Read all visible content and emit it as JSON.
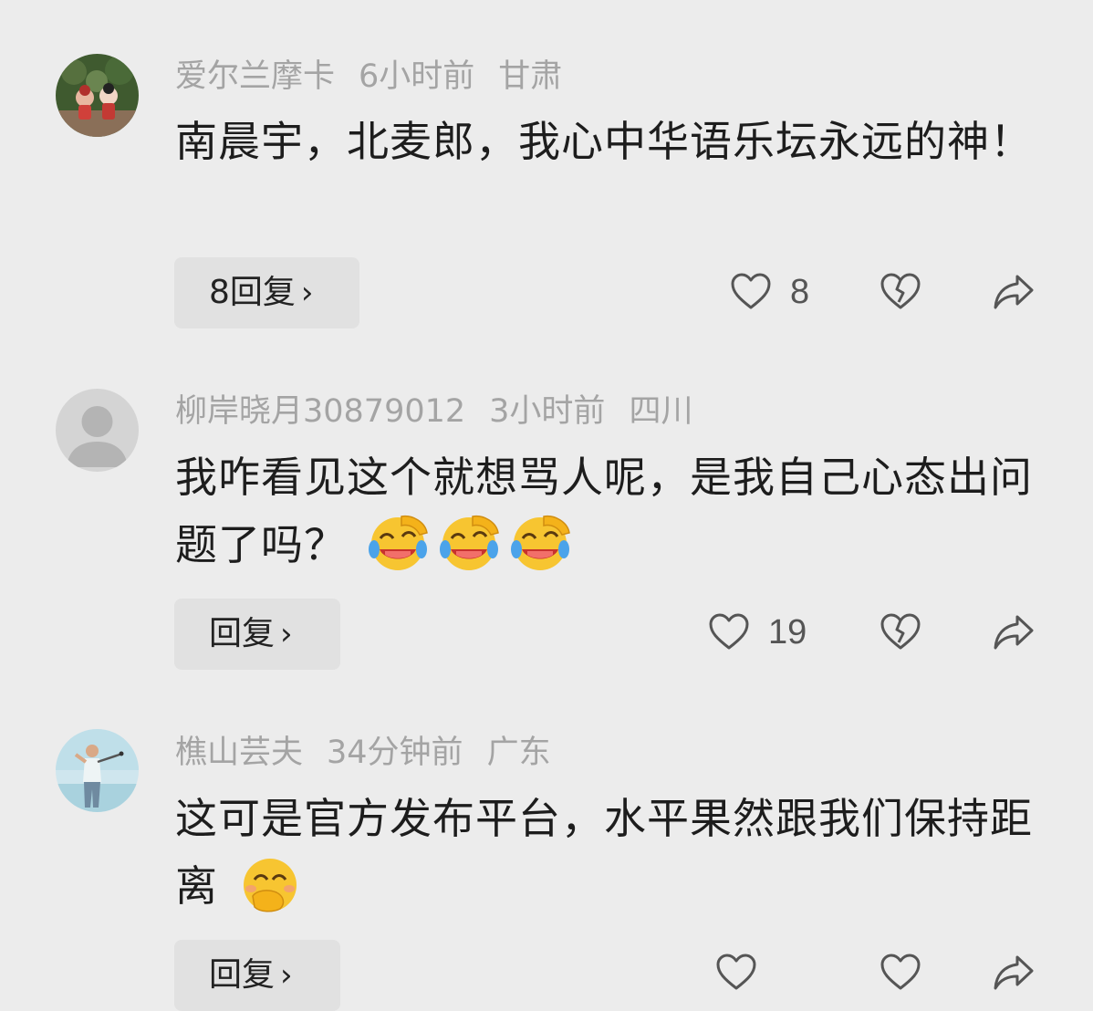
{
  "comments": [
    {
      "username": "爱尔兰摩卡",
      "time": "6小时前",
      "location": "甘肃",
      "text": "南晨宇，北麦郎，我心中华语乐坛永远的神！",
      "emoji_count": 0,
      "reply_label": "8回复",
      "like_count": "8"
    },
    {
      "username": "柳岸晓月30879012",
      "time": "3小时前",
      "location": "四川",
      "text": "我咋看见这个就想骂人呢，是我自己心态出问题了吗？",
      "emoji_count": 3,
      "emoji_name": "laughing-crying-facepalm",
      "reply_label": "回复",
      "like_count": "19"
    },
    {
      "username": "樵山芸夫",
      "time": "34分钟前",
      "location": "广东",
      "text": "这可是官方发布平台，水平果然跟我们保持距离",
      "emoji_count": 1,
      "emoji_name": "hand-over-mouth",
      "reply_label": "回复"
    }
  ],
  "icons": {
    "like": "heart-icon",
    "dislike": "broken-heart-icon",
    "share": "share-arrow-icon",
    "chevron": "chevron-right-icon"
  },
  "colors": {
    "background": "#ececec",
    "meta_text": "#a4a4a4",
    "reply_button_bg": "#e1e1e1"
  }
}
